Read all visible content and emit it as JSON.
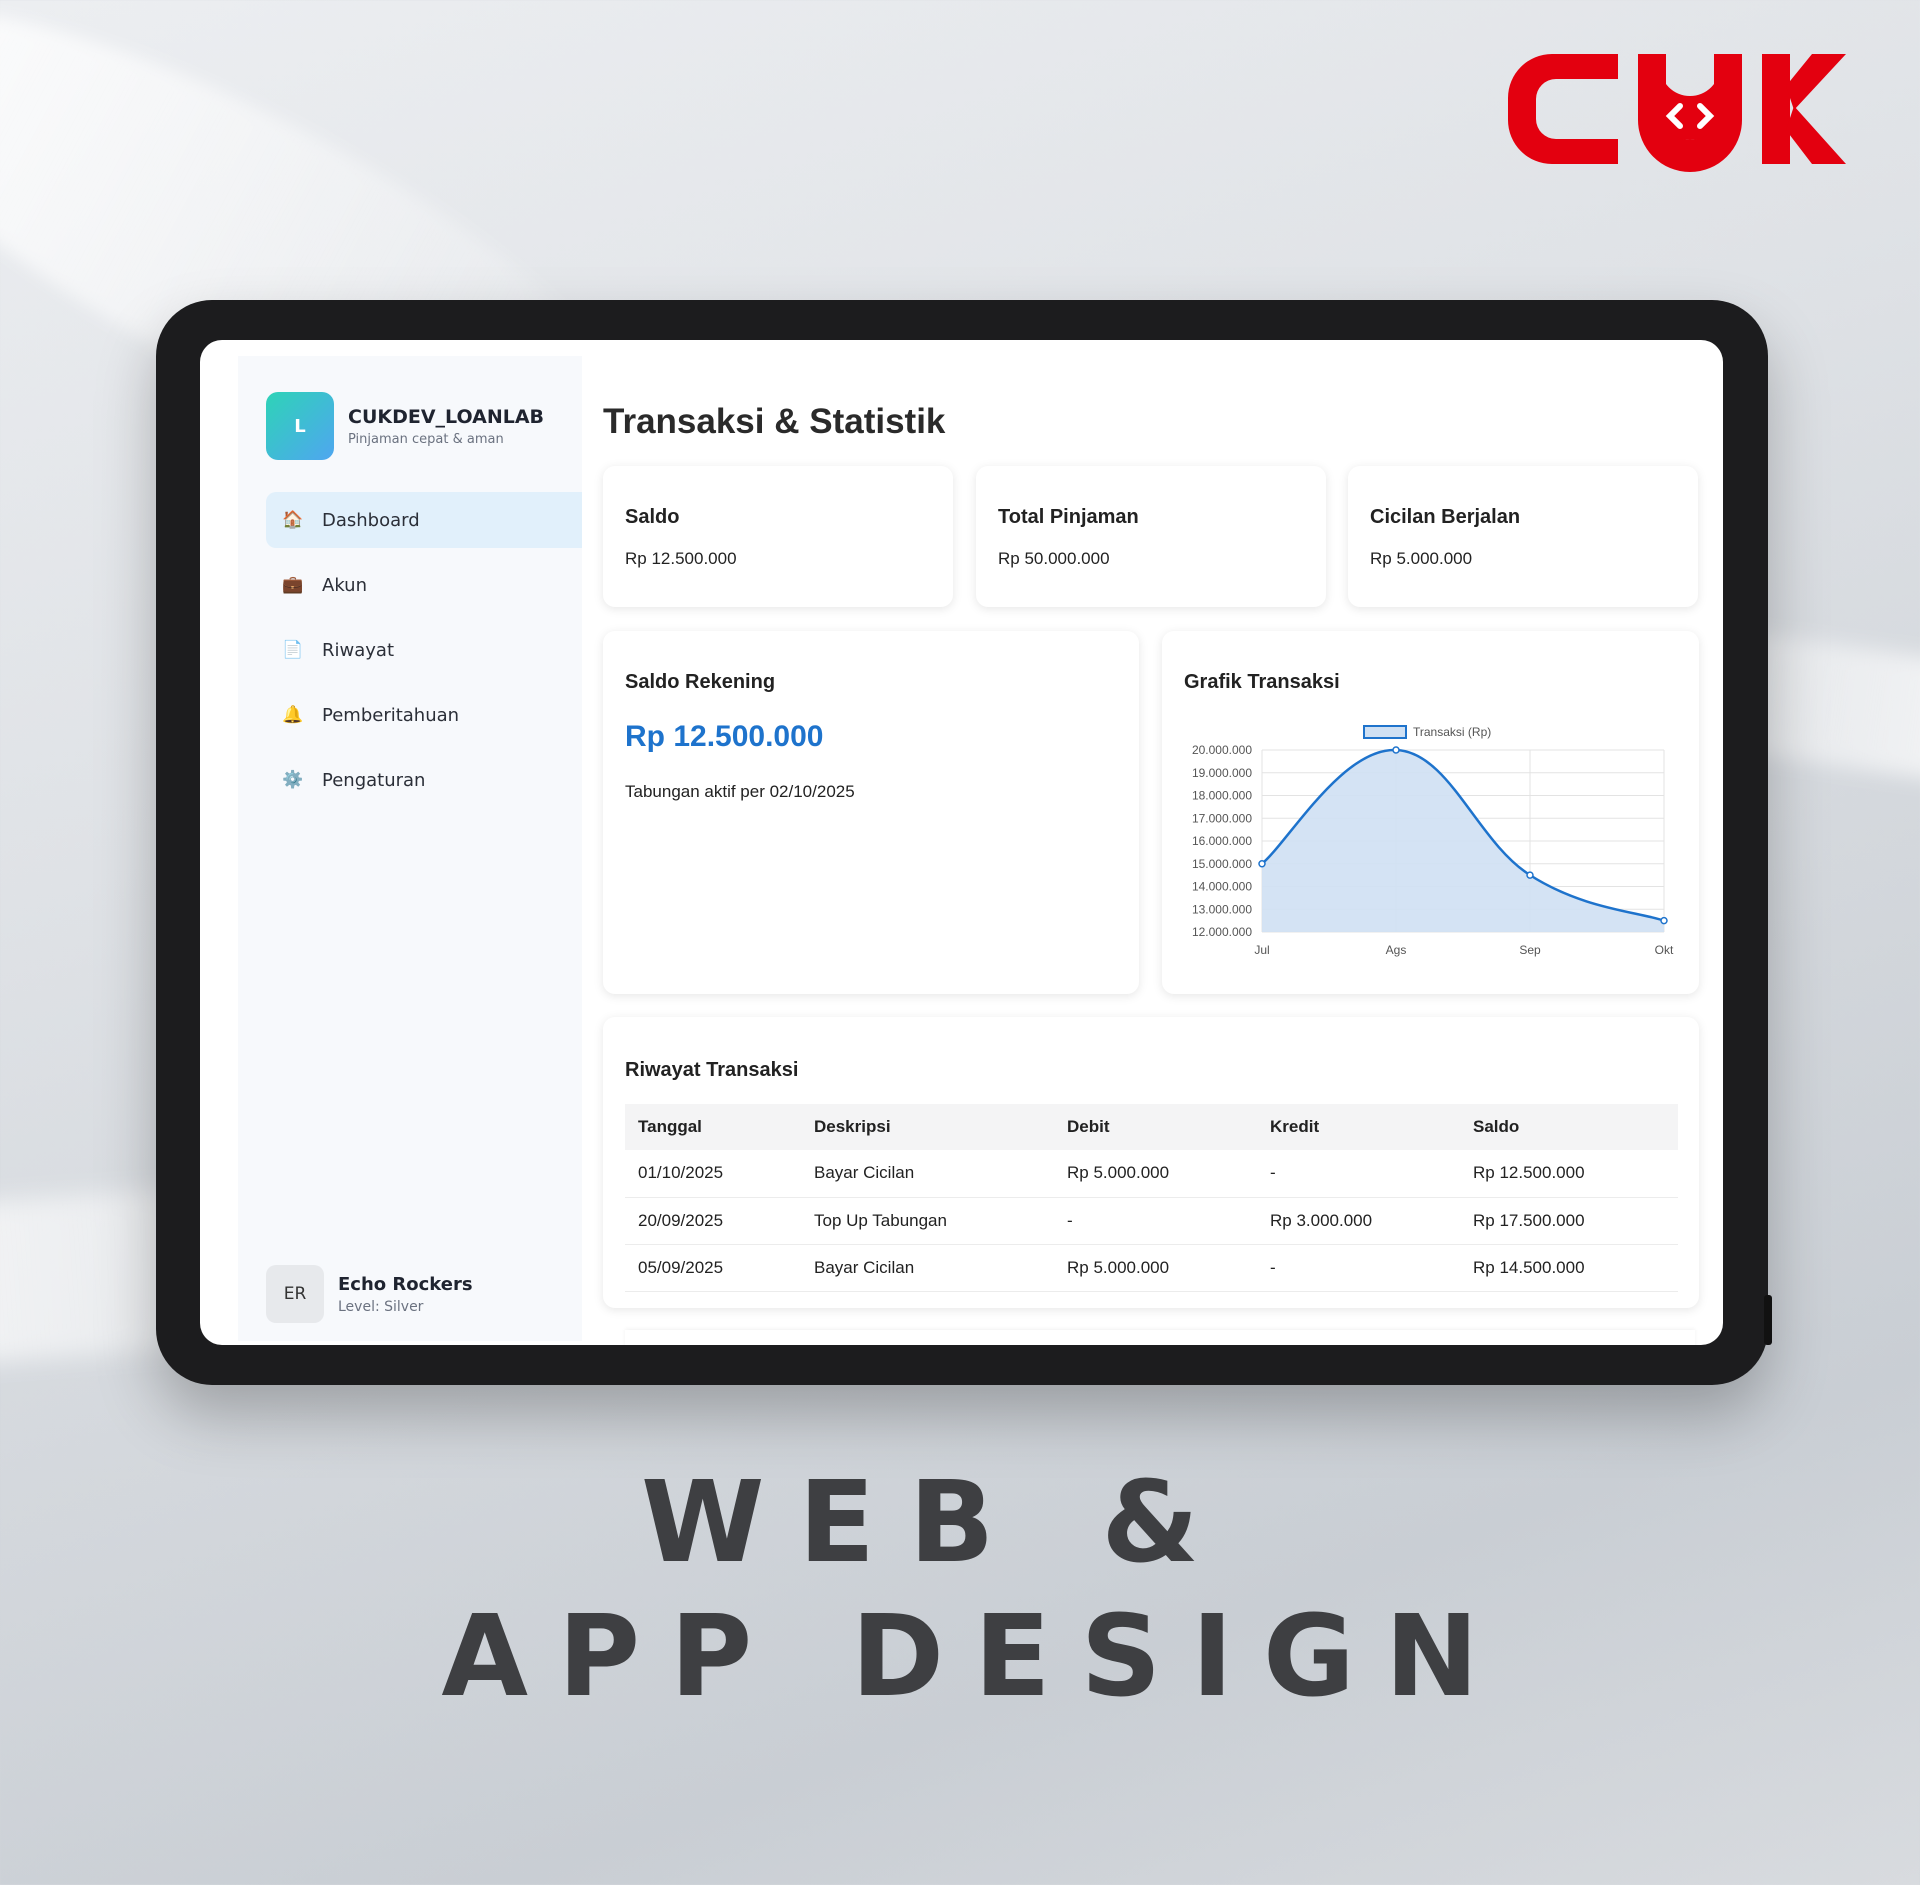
{
  "brand_logo": {
    "text": "CUK",
    "color": "#e3000f"
  },
  "caption": {
    "line1": "WEB &",
    "line2": "APP DESIGN"
  },
  "app": {
    "avatar_letter": "L",
    "name": "CUKDEV_LOANLAB",
    "tagline": "Pinjaman cepat & aman"
  },
  "nav": {
    "items": [
      {
        "label": "Dashboard",
        "icon": "house-icon",
        "active": true
      },
      {
        "label": "Akun",
        "icon": "briefcase-icon",
        "active": false
      },
      {
        "label": "Riwayat",
        "icon": "document-icon",
        "active": false
      },
      {
        "label": "Pemberitahuan",
        "icon": "bell-icon",
        "active": false
      },
      {
        "label": "Pengaturan",
        "icon": "gear-icon",
        "active": false
      }
    ]
  },
  "user": {
    "initials": "ER",
    "name": "Echo Rockers",
    "level": "Level: Silver"
  },
  "page_title": "Transaksi & Statistik",
  "stats": [
    {
      "title": "Saldo",
      "value": "Rp 12.500.000"
    },
    {
      "title": "Total Pinjaman",
      "value": "Rp 50.000.000"
    },
    {
      "title": "Cicilan Berjalan",
      "value": "Rp 5.000.000"
    }
  ],
  "saldo_rekening": {
    "title": "Saldo Rekening",
    "amount": "Rp 12.500.000",
    "note": "Tabungan aktif per 02/10/2025"
  },
  "chart_card": {
    "title": "Grafik Transaksi"
  },
  "chart_data": {
    "type": "area",
    "categories": [
      "Jul",
      "Ags",
      "Sep",
      "Okt"
    ],
    "series": [
      {
        "name": "Transaksi (Rp)",
        "values": [
          15000000,
          20000000,
          14500000,
          12500000
        ]
      }
    ],
    "ylim": [
      12000000,
      20000000
    ],
    "yticks": [
      "12.000.000",
      "13.000.000",
      "14.000.000",
      "15.000.000",
      "16.000.000",
      "17.000.000",
      "18.000.000",
      "19.000.000",
      "20.000.000"
    ],
    "grid": true,
    "legend": "top",
    "line_color": "#1e73cc",
    "fill_color": "#cfe0f3"
  },
  "history": {
    "title": "Riwayat Transaksi",
    "columns": [
      "Tanggal",
      "Deskripsi",
      "Debit",
      "Kredit",
      "Saldo"
    ],
    "rows": [
      [
        "01/10/2025",
        "Bayar Cicilan",
        "Rp 5.000.000",
        "-",
        "Rp 12.500.000"
      ],
      [
        "20/09/2025",
        "Top Up Tabungan",
        "-",
        "Rp 3.000.000",
        "Rp 17.500.000"
      ],
      [
        "05/09/2025",
        "Bayar Cicilan",
        "Rp 5.000.000",
        "-",
        "Rp 14.500.000"
      ]
    ]
  }
}
